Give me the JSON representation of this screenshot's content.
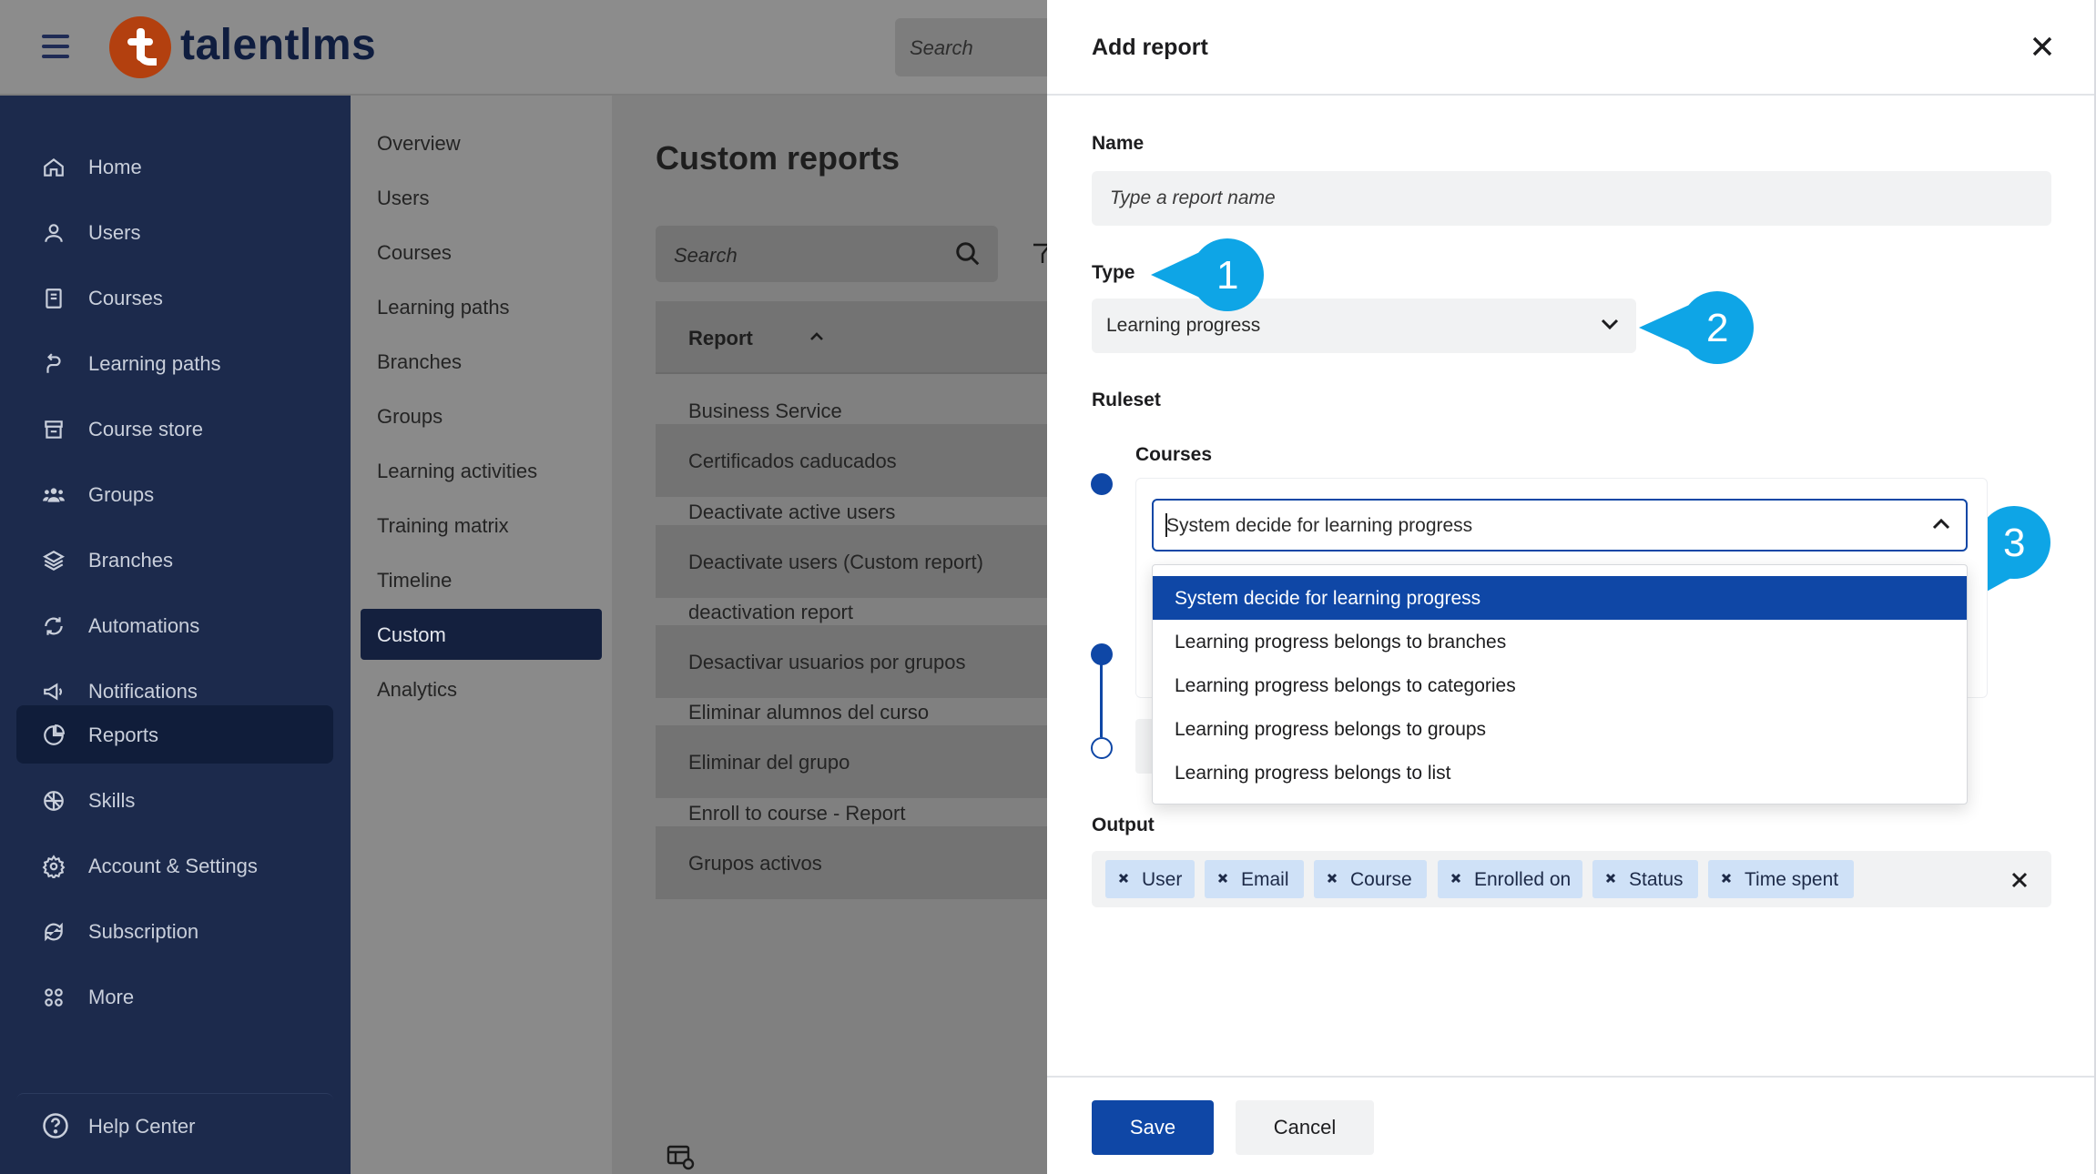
{
  "app": {
    "logo_text": "talentlms",
    "search_placeholder": "Search"
  },
  "nav": {
    "items": [
      {
        "label": "Home",
        "icon": "home-icon"
      },
      {
        "label": "Users",
        "icon": "user-icon"
      },
      {
        "label": "Courses",
        "icon": "book-icon"
      },
      {
        "label": "Learning paths",
        "icon": "path-icon"
      },
      {
        "label": "Course store",
        "icon": "store-icon"
      },
      {
        "label": "Groups",
        "icon": "group-icon"
      },
      {
        "label": "Branches",
        "icon": "layers-icon"
      },
      {
        "label": "Automations",
        "icon": "automation-icon"
      },
      {
        "label": "Notifications",
        "icon": "megaphone-icon"
      },
      {
        "label": "Reports",
        "icon": "pie-chart-icon",
        "active": true
      },
      {
        "label": "Skills",
        "icon": "skills-icon"
      },
      {
        "label": "Account & Settings",
        "icon": "gear-icon"
      },
      {
        "label": "Subscription",
        "icon": "subscription-icon"
      },
      {
        "label": "More",
        "icon": "grid-dots-icon"
      }
    ],
    "help": "Help Center"
  },
  "subnav": {
    "items": [
      "Overview",
      "Users",
      "Courses",
      "Learning paths",
      "Branches",
      "Groups",
      "Learning activities",
      "Training matrix",
      "Timeline",
      "Custom",
      "Analytics"
    ],
    "active": "Custom"
  },
  "main": {
    "title": "Custom reports",
    "search_placeholder": "Search",
    "column_header": "Report",
    "rows": [
      "Business Service",
      "Certificados caducados",
      "Deactivate active users",
      "Deactivate users (Custom report)",
      "deactivation report",
      "Desactivar usuarios por grupos",
      "Eliminar alumnos del curso",
      "Eliminar del grupo",
      "Enroll to course - Report",
      "Grupos activos"
    ]
  },
  "modal": {
    "title": "Add report",
    "name_label": "Name",
    "name_placeholder": "Type a report name",
    "type_label": "Type",
    "type_value": "Learning progress",
    "ruleset_label": "Ruleset",
    "rule_label": "Courses",
    "rule_value": "System decide for learning progress",
    "rule_options": [
      "System decide for learning progress",
      "Learning progress belongs to branches",
      "Learning progress belongs to categories",
      "Learning progress belongs to groups",
      "Learning progress belongs to list"
    ],
    "output_label": "Output",
    "output_chips": [
      "User",
      "Email",
      "Course",
      "Enrolled on",
      "Status",
      "Time spent"
    ],
    "save": "Save",
    "cancel": "Cancel"
  },
  "callouts": [
    "1",
    "2",
    "3"
  ],
  "colors": {
    "primary": "#0f47a6",
    "nav_bg": "#1c2a4c",
    "callout": "#0ea5e6",
    "chip": "#cfe1f7"
  }
}
